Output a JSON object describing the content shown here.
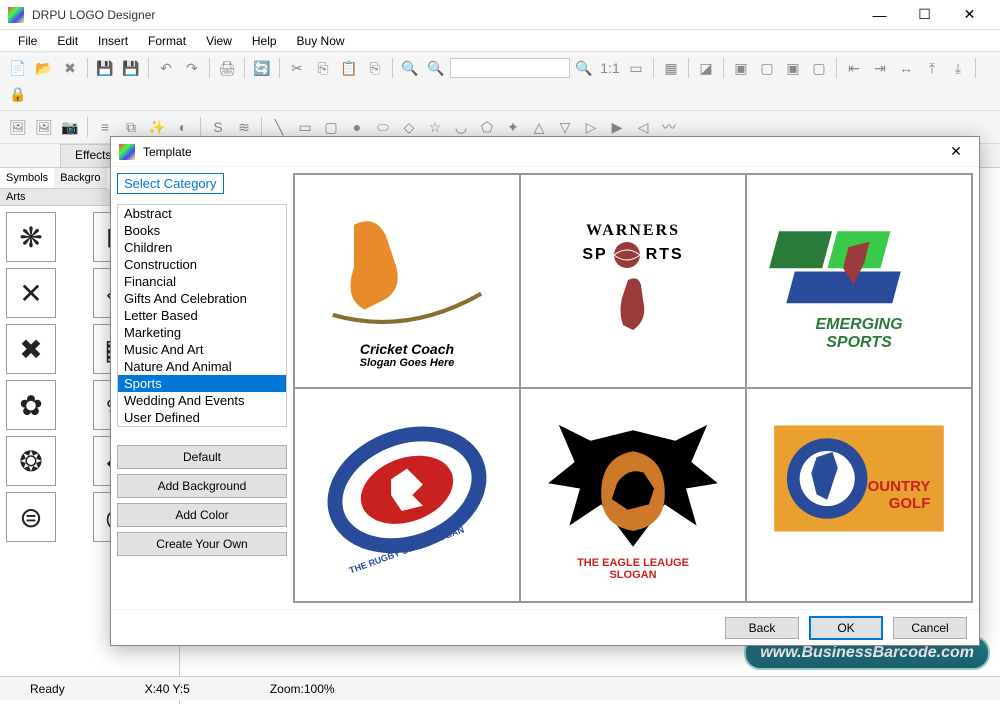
{
  "window": {
    "title": "DRPU LOGO Designer"
  },
  "menu": [
    "File",
    "Edit",
    "Insert",
    "Format",
    "View",
    "Help",
    "Buy Now"
  ],
  "tabs": {
    "effects": "Effects"
  },
  "side_tabs": {
    "symbols": "Symbols",
    "background": "Backgro"
  },
  "side_header": "Arts",
  "statusbar": {
    "ready": "Ready",
    "xy": "X:40  Y:5",
    "zoom": "Zoom:100%"
  },
  "watermark": "www.BusinessBarcode.com",
  "modal": {
    "title": "Template",
    "select_category": "Select Category",
    "categories": [
      "Abstract",
      "Books",
      "Children",
      "Construction",
      "Financial",
      "Gifts And Celebration",
      "Letter Based",
      "Marketing",
      "Music And Art",
      "Nature And Animal",
      "Sports",
      "Wedding And Events",
      "User Defined"
    ],
    "selected_category_index": 10,
    "buttons": {
      "default": "Default",
      "add_background": "Add Background",
      "add_color": "Add Color",
      "create_own": "Create Your Own"
    },
    "footer": {
      "back": "Back",
      "ok": "OK",
      "cancel": "Cancel"
    },
    "templates": [
      {
        "line1": "Cricket Coach",
        "line2": "Slogan Goes Here"
      },
      {
        "line1": "WARNERS",
        "line2": "SP  RTS"
      },
      {
        "line1": "EMERGING",
        "line2": "SPORTS"
      },
      {
        "line1": "THE RUGBY CLUB",
        "line2": "SLOGAN"
      },
      {
        "line1": "THE EAGLE LEAUGE",
        "line2": "SLOGAN"
      },
      {
        "line1": "OUNTRY",
        "line2": "GOLF"
      }
    ]
  }
}
